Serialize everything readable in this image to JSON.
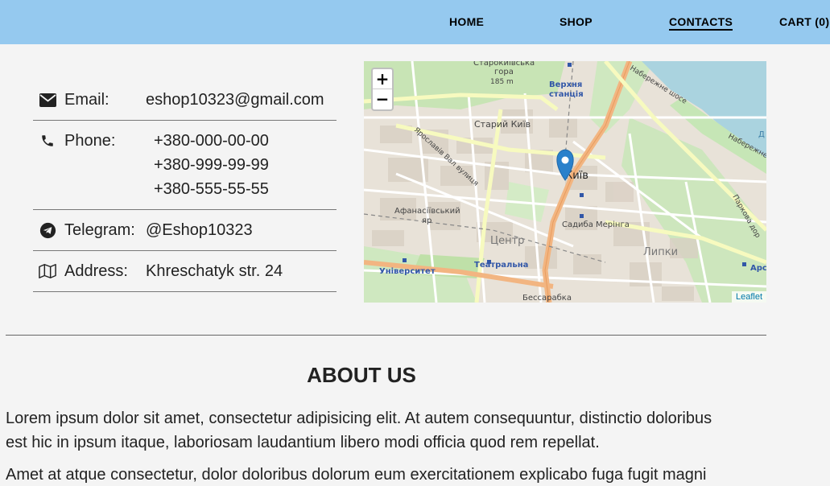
{
  "nav": {
    "home": "HOME",
    "shop": "SHOP",
    "contacts": "CONTACTS",
    "cart": "CART (0)"
  },
  "contacts": {
    "email_label": "Email:",
    "email_value": "eshop10323@gmail.com",
    "phone_label": "Phone:",
    "phones": [
      "+380-000-00-00",
      "+380-999-99-99",
      "+380-555-55-55"
    ],
    "telegram_label": "Telegram:",
    "telegram_value": "@Eshop10323",
    "address_label": "Address:",
    "address_value": "Khreschatyk str. 24"
  },
  "map": {
    "zoom_in": "+",
    "zoom_out": "−",
    "attribution": "Leaflet",
    "places": {
      "starokyivska": "Старокиївська",
      "hora": "гора",
      "elev": "185 m",
      "verkhnia_1": "Верхня",
      "verkhnia_2": "станція",
      "staryi_kyiv": "Старий Київ",
      "yaroslaviv": "Ярославів Вал вулиця",
      "kyiv": "Київ",
      "afanasiivskyi_1": "Афанасіївський",
      "afanasiivskyi_2": "яр",
      "sadyba": "Садиба Мерінга",
      "tsentr": "Центр",
      "lypky": "Липки",
      "teatralna": "Театральна",
      "universytet": "Університет",
      "bessarabka": "Бессарабка",
      "naberezhne_1": "Набережне шосе",
      "naberezhne_2": "Набережне ш",
      "parkova": "Паркова дор",
      "ars": "Арс",
      "d_label": "Д"
    }
  },
  "about": {
    "title": "ABOUT US",
    "para1_line1": "Lorem ipsum dolor sit amet, consectetur adipisicing elit. At autem consequuntur, distinctio doloribus",
    "para1_line2": "est hic in ipsum itaque, laboriosam laudantium libero modi officia quod rem repellat.",
    "para2_line1": "Amet at atque consectetur, dolor doloribus dolorum eum exercitationem explicabo fuga fugit magni"
  },
  "colors": {
    "nav_bg": "#95c9ef",
    "page_bg": "#f4f4f4",
    "marker": "#2a81cb",
    "leaflet_link": "#0078a8"
  }
}
